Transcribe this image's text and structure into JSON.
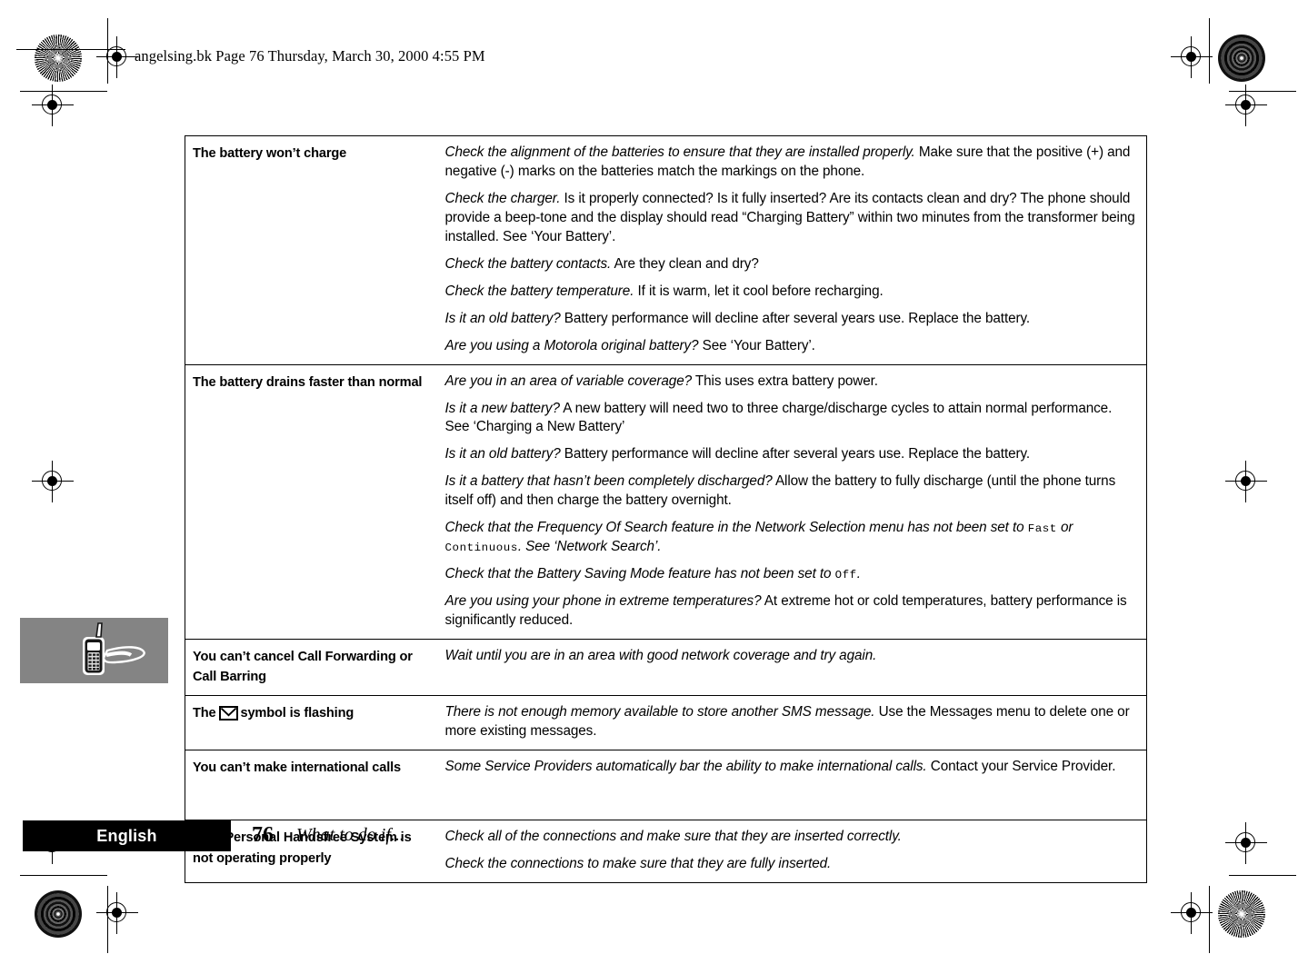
{
  "page": {
    "slug": "angelsing.bk  Page 76  Thursday, March 30, 2000  4:55 PM",
    "folio": "76",
    "running_head": "What to do if...",
    "language_tab": "English",
    "margin_figure_alt": "mobile-phone-illustration"
  },
  "table": {
    "rows": [
      {
        "symptom": "The battery won’t charge",
        "fixes": [
          {
            "lead": "Check the alignment of the batteries to ensure that they are installed properly.",
            "rest": " Make sure that the positive (+) and negative (-) marks on the batteries match the markings on the phone."
          },
          {
            "lead": "Check the charger.",
            "rest": " Is it properly connected? Is it fully inserted? Are its contacts clean and dry? The phone should provide a beep-tone and the display should read “Charging Battery” within two minutes from the transformer being installed. See ‘Your Battery’."
          },
          {
            "lead": "Check the battery contacts.",
            "rest": " Are they clean and dry?"
          },
          {
            "lead": "Check the battery temperature.",
            "rest": " If it is warm, let it cool before recharging."
          },
          {
            "lead": "Is it an old battery?",
            "rest": " Battery performance will decline after several years use. Replace the battery."
          },
          {
            "lead": "Are you using a Motorola original battery?",
            "rest": " See ‘Your Battery’."
          }
        ]
      },
      {
        "symptom": "The battery drains faster than normal",
        "fixes": [
          {
            "lead": "Are you in an area of variable coverage?",
            "rest": " This uses extra battery power."
          },
          {
            "lead": "Is it a new battery?",
            "rest": " A new battery will need two to three charge/discharge cycles to attain normal performance. See ‘Charging a New Battery’"
          },
          {
            "lead": "Is it an old battery?",
            "rest": " Battery performance will decline after several years use. Replace the battery."
          },
          {
            "lead": "Is it a battery that hasn’t been completely discharged?",
            "rest": " Allow the battery to fully discharge (until the phone turns itself off) and then charge the battery overnight."
          },
          {
            "lead": "Check that the Frequency Of Search feature in the Network Selection menu has not been set to ",
            "mono1": "Fast",
            "mid": " or ",
            "mono2": "Continuous",
            "tail": ". See ‘Network Search’.",
            "rest": ""
          },
          {
            "lead": "Check that the Battery Saving Mode feature has not been set to ",
            "mono1": "Off",
            "tail": ".",
            "rest": ""
          },
          {
            "lead": "Are you using your phone in extreme temperatures?",
            "rest": " At extreme hot or cold temperatures, battery performance is significantly reduced."
          }
        ]
      },
      {
        "symptom": "You can’t cancel Call Forwarding or Call Barring",
        "fixes": [
          {
            "lead": "Wait until you are in an area with good network coverage and try again.",
            "rest": ""
          }
        ]
      },
      {
        "symptom_pre": "The",
        "symptom_icon": "envelope-icon",
        "symptom_post": "symbol is flashing",
        "fixes": [
          {
            "lead": "There is not enough memory available to store another SMS message.",
            "rest": " Use the Messages menu to delete one or more existing messages."
          }
        ]
      },
      {
        "symptom": "You can’t make international calls",
        "fixes": [
          {
            "lead": "Some Service Providers automatically bar the ability to make international calls.",
            "rest": " Contact your Service Provider."
          }
        ]
      },
      {
        "symptom": "Your Personal Handsfree System is not operating properly",
        "fixes": [
          {
            "lead": "Check all of the connections and make sure that they are inserted correctly.",
            "rest": ""
          },
          {
            "lead": "Check the connections to make sure that they are fully inserted.",
            "rest": ""
          }
        ]
      }
    ]
  },
  "colors": {
    "page_background": "#ffffff",
    "ink": "#000000",
    "figure_background": "#848484",
    "language_tab_background": "#000000",
    "language_tab_text": "#ffffff"
  }
}
